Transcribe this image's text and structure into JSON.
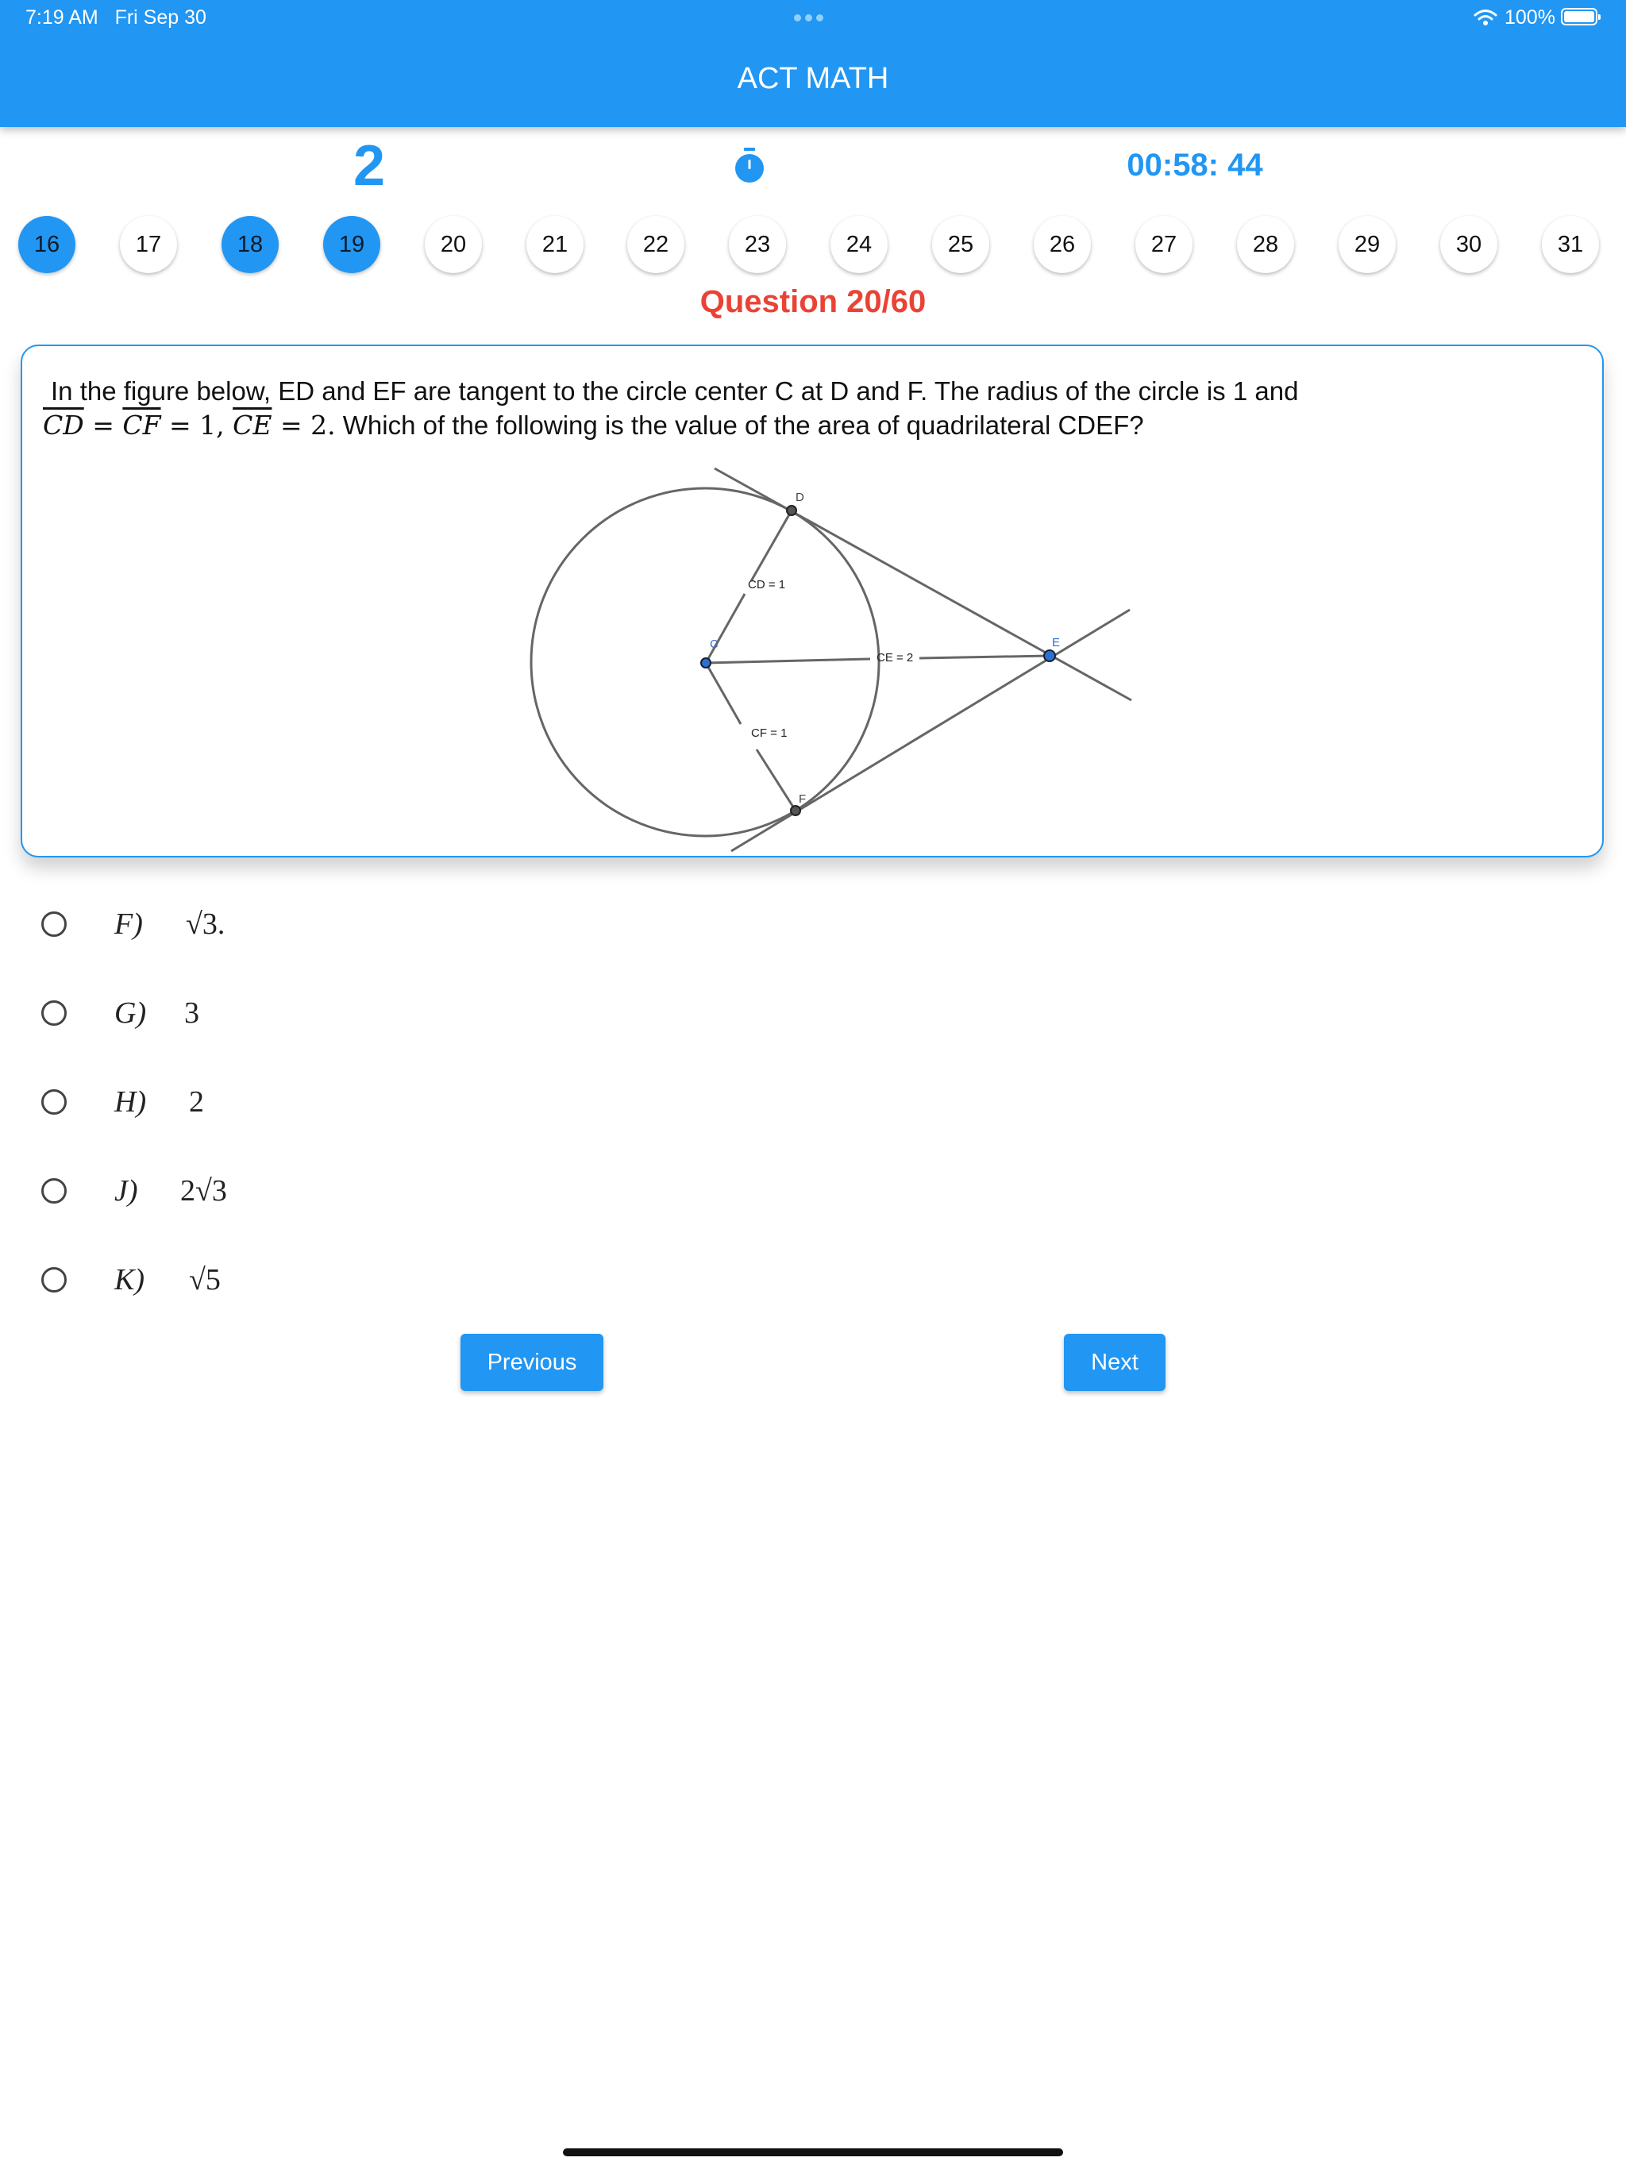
{
  "status_bar": {
    "time": "7:19 AM",
    "date": "Fri Sep 30",
    "battery": "100%"
  },
  "app": {
    "title": "ACT MATH"
  },
  "header": {
    "score": "2",
    "timer": "00:58: 44"
  },
  "question_nav": {
    "numbers": [
      "16",
      "17",
      "18",
      "19",
      "20",
      "21",
      "22",
      "23",
      "24",
      "25",
      "26",
      "27",
      "28",
      "29",
      "30",
      "31"
    ],
    "answered": [
      "16",
      "18",
      "19"
    ]
  },
  "question": {
    "label": "Question 20/60",
    "text_line1": "In the figure below, ED and EF are tangent to the circle center C at D and F.  The radius of the circle is 1 and",
    "math_cd": "CD",
    "math_cf": "CF",
    "math_eq1": " = ",
    "math_eq2": " = 1, ",
    "math_ce": "CE",
    "math_eq3": " = 2.",
    "text_line2_rest": " Which of the following is the value of the area of quadrilateral CDEF?",
    "figure": {
      "labels": {
        "d": "D",
        "c": "C",
        "e": "E",
        "f": "F"
      },
      "cd": "CD = 1",
      "ce": "CE = 2",
      "cf": "CF = 1"
    }
  },
  "options": [
    {
      "letter": "F)",
      "value": "√3."
    },
    {
      "letter": "G)",
      "value": "3"
    },
    {
      "letter": "H)",
      "value": "2"
    },
    {
      "letter": "J)",
      "value": "2√3"
    },
    {
      "letter": "K)",
      "value": "√5"
    }
  ],
  "buttons": {
    "previous": "Previous",
    "next": "Next"
  },
  "colors": {
    "primary": "#2196F3",
    "question_label": "#EA4335"
  }
}
